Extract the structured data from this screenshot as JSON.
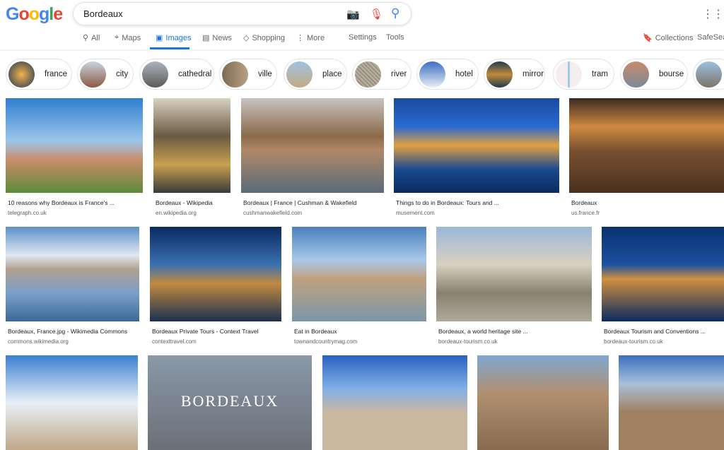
{
  "logo": "Google",
  "search": {
    "query": "Bordeaux"
  },
  "tabs": [
    {
      "label": "All"
    },
    {
      "label": "Maps"
    },
    {
      "label": "Images"
    },
    {
      "label": "News"
    },
    {
      "label": "Shopping"
    },
    {
      "label": "More"
    }
  ],
  "settings": "Settings",
  "tools": "Tools",
  "collections": "Collections",
  "safesearch": "SafeSear",
  "chips": [
    "france",
    "city",
    "cathedral",
    "ville",
    "place",
    "river",
    "hotel",
    "mirror",
    "tram",
    "bourse",
    ""
  ],
  "results": [
    {
      "title": "10 reasons why Bordeaux is France's ...",
      "source": "telegraph.co.uk"
    },
    {
      "title": "Bordeaux - Wikipedia",
      "source": "en.wikipedia.org"
    },
    {
      "title": "Bordeaux | France | Cushman & Wakefield",
      "source": "cushmanwakefield.com"
    },
    {
      "title": "Things to do in Bordeaux: Tours and ...",
      "source": "musement.com"
    },
    {
      "title": "Bordeaux",
      "source": "us.france.fr"
    },
    {
      "title": "Bordeaux, France.jpg - Wikimedia Commons",
      "source": "commons.wikimedia.org"
    },
    {
      "title": "Bordeaux Private Tours - Context Travel",
      "source": "contexttravel.com"
    },
    {
      "title": "Eat in Bordeaux",
      "source": "townandcountrymag.com"
    },
    {
      "title": "Bordeaux, a world heritage site ...",
      "source": "bordeaux-tourism.co.uk"
    },
    {
      "title": "Bordeaux Tourism and Conventions ...",
      "source": "bordeaux-tourism.co.uk"
    }
  ],
  "row3_overlay": "BORDEAUX",
  "colors": {
    "accent": "#1a73e8"
  }
}
